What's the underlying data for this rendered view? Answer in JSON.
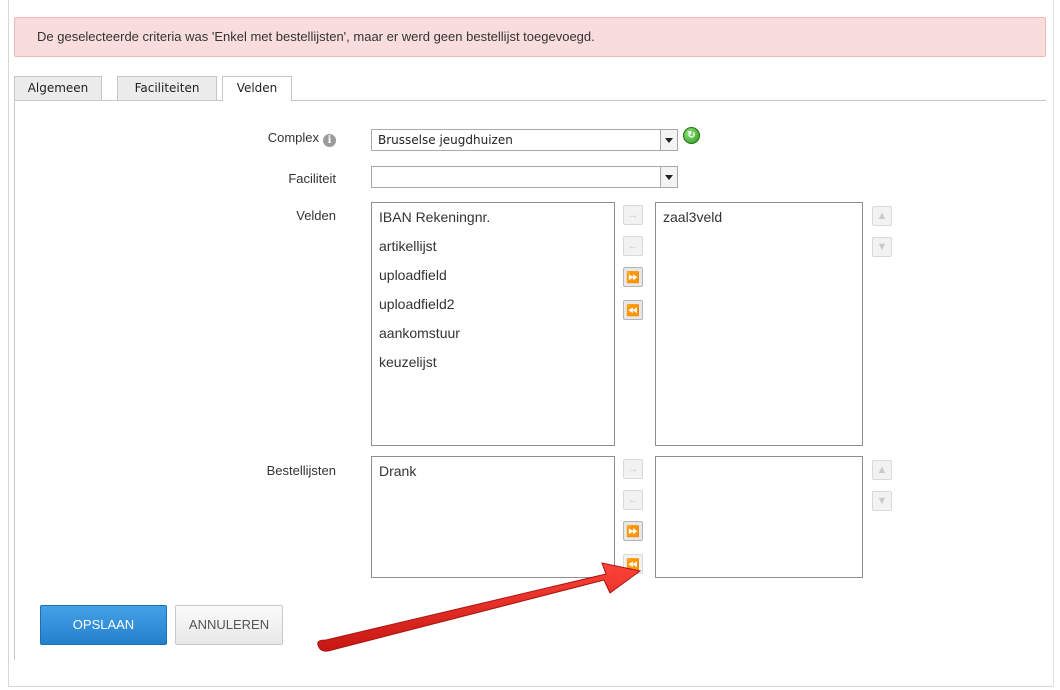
{
  "alert": {
    "message": "De geselecteerde criteria was 'Enkel met bestellijsten', maar er werd geen bestellijst toegevoegd."
  },
  "tabs": [
    {
      "label": "Algemeen",
      "active": false
    },
    {
      "label": "Faciliteiten",
      "active": false
    },
    {
      "label": "Velden",
      "active": true
    }
  ],
  "form": {
    "complex": {
      "label": "Complex",
      "value": "Brusselse jeugdhuizen",
      "info_icon": "info-icon",
      "refresh_icon": "refresh-icon"
    },
    "faciliteit": {
      "label": "Faciliteit",
      "value": ""
    },
    "velden": {
      "label": "Velden",
      "available": [
        "IBAN Rekeningnr.",
        "artikellijst",
        "uploadfield",
        "uploadfield2",
        "aankomstuur",
        "keuzelijst"
      ],
      "selected": [
        "zaal3veld"
      ]
    },
    "bestellijsten": {
      "label": "Bestellijsten",
      "available": [
        "Drank"
      ],
      "selected": []
    }
  },
  "transfer_icons": {
    "move_right": "→",
    "move_left": "←",
    "move_all_right": "⏩",
    "move_all_left": "⏪",
    "move_up": "▲",
    "move_down": "▼"
  },
  "actions": {
    "save_label": "OPSLAAN",
    "cancel_label": "ANNULEREN"
  },
  "colors": {
    "alert_bg": "#f9dcdc",
    "primary": "#2e8ed9",
    "arrow_annotation": "#e8100d"
  }
}
